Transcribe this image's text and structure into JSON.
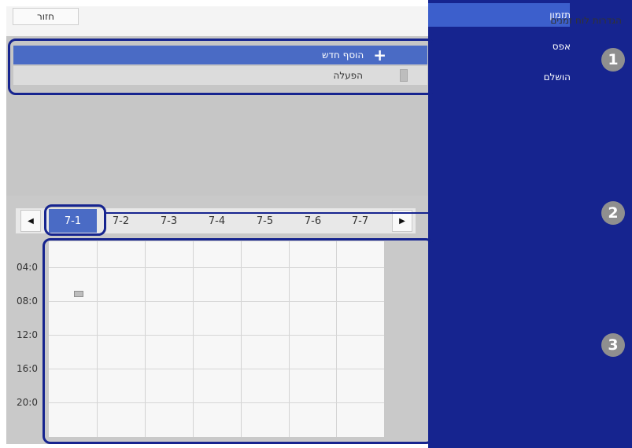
{
  "header": {
    "title": "הגדרות לוח זמנים",
    "back_label": "חזור"
  },
  "list": {
    "add_new_label": "הוסף חדש",
    "activate_label": "הפעלה"
  },
  "sidebar": {
    "items": [
      "תזמון",
      "אפס",
      "הושלם"
    ]
  },
  "tabs": [
    "7-1",
    "7-2",
    "7-3",
    "7-4",
    "7-5",
    "7-6",
    "7-7"
  ],
  "times": [
    "04:0",
    "08:0",
    "12:0",
    "16:0",
    "20:0"
  ],
  "callouts": [
    "1",
    "2",
    "3"
  ],
  "colors": {
    "sidebar": "#16248f",
    "selected": "#4a6bc5",
    "panel": "#c9c9c9"
  }
}
